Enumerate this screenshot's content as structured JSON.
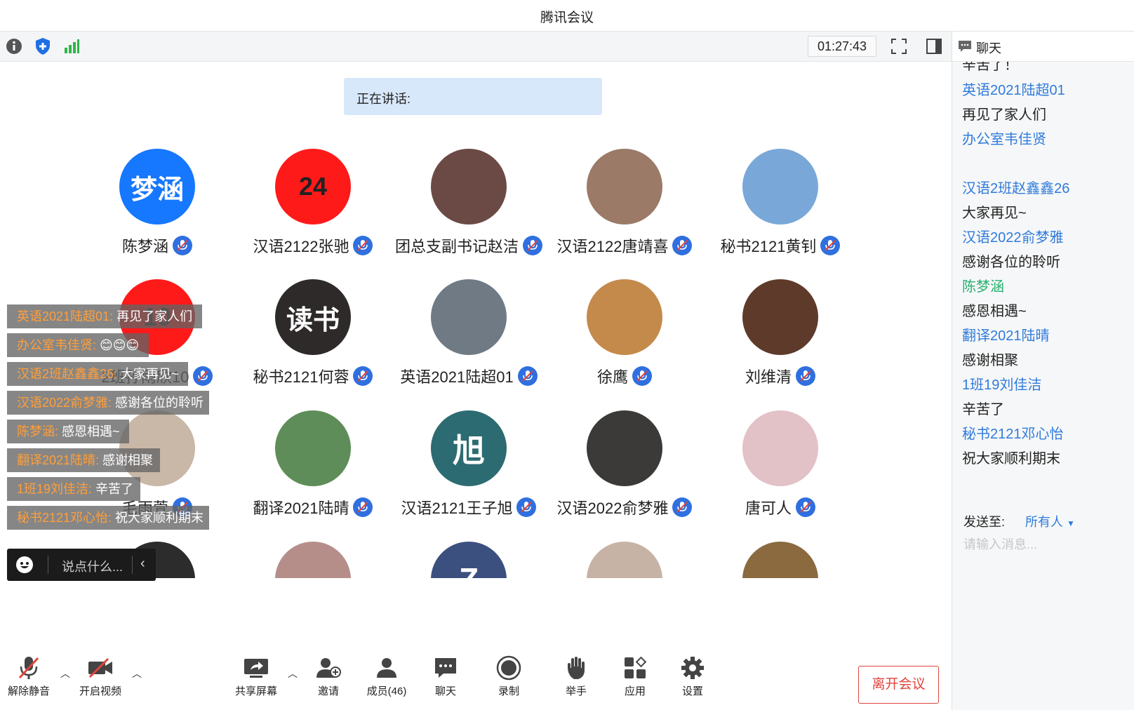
{
  "window": {
    "title": "腾讯会议"
  },
  "toolbar": {
    "timer": "01:27:43",
    "icons": [
      "info-icon",
      "security-shield-icon",
      "signal-icon",
      "fullscreen-icon",
      "sidebar-toggle-icon"
    ]
  },
  "speaking": {
    "label": "正在讲话:"
  },
  "participants": [
    {
      "name": "陈梦涵",
      "avatar_text": "梦涵",
      "color": "#1677ff"
    },
    {
      "name": "汉语2122张驰",
      "avatar_text": "24",
      "color": "#ff1a1a"
    },
    {
      "name": "团总支副书记赵洁",
      "avatar_text": "",
      "color": "#6b4a45"
    },
    {
      "name": "汉语2122唐靖喜",
      "avatar_text": "",
      "color": "#9b7a68"
    },
    {
      "name": "秘书2121黄钊",
      "avatar_text": "",
      "color": "#79a8d8"
    },
    {
      "name": "2班孙雨欣10",
      "avatar_text": "10",
      "color": "#ff1a1a"
    },
    {
      "name": "秘书2121何蓉",
      "avatar_text": "读书",
      "color": "#2d2a29"
    },
    {
      "name": "英语2021陆超01",
      "avatar_text": "",
      "color": "#6f7a84"
    },
    {
      "name": "徐鹰",
      "avatar_text": "",
      "color": "#c48a4b"
    },
    {
      "name": "刘维清",
      "avatar_text": "",
      "color": "#5e3a2b"
    },
    {
      "name": "毛雨萱",
      "avatar_text": "",
      "color": "#c9b7a7"
    },
    {
      "name": "翻译2021陆晴",
      "avatar_text": "",
      "color": "#5f8d59"
    },
    {
      "name": "汉语2121王子旭",
      "avatar_text": "旭",
      "color": "#2d6b72"
    },
    {
      "name": "汉语2022俞梦雅",
      "avatar_text": "",
      "color": "#3b3a38"
    },
    {
      "name": "唐可人",
      "avatar_text": "",
      "color": "#e2c1c7"
    },
    {
      "name": "",
      "avatar_text": "",
      "color": "#2c2c2c"
    },
    {
      "name": "",
      "avatar_text": "",
      "color": "#b58e8a"
    },
    {
      "name": "",
      "avatar_text": "Z",
      "color": "#3c5080"
    },
    {
      "name": "",
      "avatar_text": "",
      "color": "#c6b3a6"
    },
    {
      "name": "",
      "avatar_text": "",
      "color": "#8a6a3e"
    }
  ],
  "danmaku": [
    {
      "who": "英语2021陆超01:",
      "text": " 再见了家人们"
    },
    {
      "who": "办公室韦佳贤:",
      "text": " 😊😊😊"
    },
    {
      "who": "汉语2班赵鑫鑫26:",
      "text": " 大家再见~"
    },
    {
      "who": "汉语2022俞梦雅:",
      "text": " 感谢各位的聆听"
    },
    {
      "who": "陈梦涵:",
      "text": " 感恩相遇~"
    },
    {
      "who": "翻译2021陆晴:",
      "text": " 感谢相聚"
    },
    {
      "who": "1班19刘佳洁:",
      "text": " 辛苦了"
    },
    {
      "who": "秘书2121邓心怡:",
      "text": " 祝大家顺利期末"
    }
  ],
  "say_box": {
    "placeholder": "说点什么..."
  },
  "chat": {
    "header": "聊天",
    "partial_top": "辛苦了！",
    "messages": [
      {
        "sender": "英语2021陆超01",
        "text": "再见了家人们"
      },
      {
        "sender": "办公室韦佳贤",
        "text": ""
      },
      {
        "sender": "汉语2班赵鑫鑫26",
        "text": "大家再见~"
      },
      {
        "sender": "汉语2022俞梦雅",
        "text": "感谢各位的聆听"
      },
      {
        "sender": "陈梦涵",
        "text": "感恩相遇~"
      },
      {
        "sender": "翻译2021陆晴",
        "text": "感谢相聚"
      },
      {
        "sender": "1班19刘佳洁",
        "text": "辛苦了"
      },
      {
        "sender": "秘书2121邓心怡",
        "text": "祝大家顺利期末"
      }
    ],
    "send_to_label": "发送至:",
    "send_to_value": "所有人",
    "input_placeholder": "请输入消息..."
  },
  "bottom_bar": {
    "unmute": "解除静音",
    "video": "开启视频",
    "share": "共享屏幕",
    "invite": "邀请",
    "members": "成员(46)",
    "chat": "聊天",
    "record": "录制",
    "raise_hand": "举手",
    "apps": "应用",
    "settings": "设置",
    "leave": "离开会议"
  },
  "colors": {
    "accent": "#2f6fe0",
    "leave": "#e0443c",
    "speaking_bg": "#d8e8fb"
  }
}
